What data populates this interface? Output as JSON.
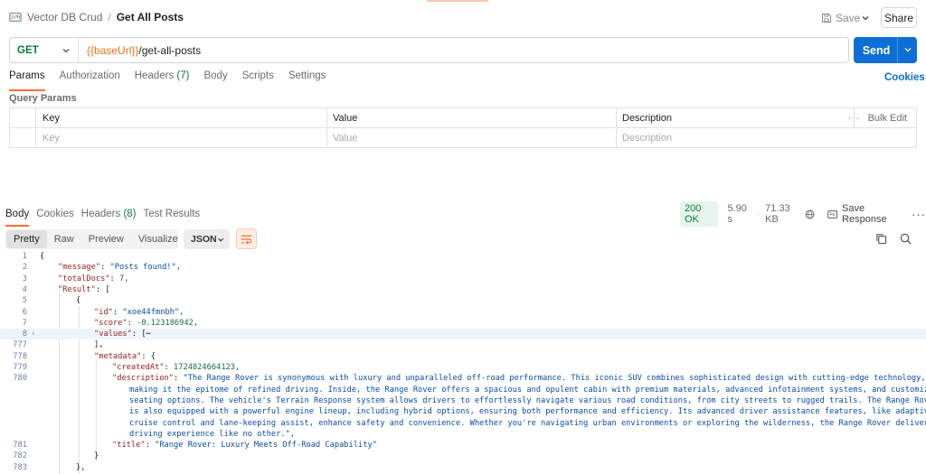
{
  "header": {
    "collection": "Vector DB Crud",
    "separator": "/",
    "request_name": "Get All Posts",
    "save_label": "Save",
    "share_label": "Share"
  },
  "request": {
    "method": "GET",
    "url_var": "{{baseUrl}}",
    "url_path": "/get-all-posts",
    "send_label": "Send"
  },
  "request_tabs": [
    {
      "label": "Params",
      "count": ""
    },
    {
      "label": "Authorization",
      "count": ""
    },
    {
      "label": "Headers",
      "count": "(7)"
    },
    {
      "label": "Body",
      "count": ""
    },
    {
      "label": "Scripts",
      "count": ""
    },
    {
      "label": "Settings",
      "count": ""
    }
  ],
  "cookies_link": "Cookies",
  "query_params": {
    "title": "Query Params",
    "columns": [
      "Key",
      "Value",
      "Description"
    ],
    "bulk_edit": "Bulk Edit",
    "placeholders": [
      "Key",
      "Value",
      "Description"
    ]
  },
  "response_tabs": [
    {
      "label": "Body",
      "count": ""
    },
    {
      "label": "Cookies",
      "count": ""
    },
    {
      "label": "Headers",
      "count": "(8)"
    },
    {
      "label": "Test Results",
      "count": ""
    }
  ],
  "response_meta": {
    "status": "200 OK",
    "time": "5.90 s",
    "size": "71.33 KB",
    "save_response": "Save Response"
  },
  "viewer": {
    "modes": [
      "Pretty",
      "Raw",
      "Preview",
      "Visualize"
    ],
    "format": "JSON"
  },
  "code_lines": [
    {
      "num": "1",
      "text": "{"
    },
    {
      "num": "2",
      "text": "\"message\": \"Posts found!\","
    },
    {
      "num": "3",
      "text": "\"totalDocs\": 7,"
    },
    {
      "num": "4",
      "text": "\"Result\": ["
    },
    {
      "num": "5",
      "text": "{"
    },
    {
      "num": "6",
      "text": "\"id\": \"xoe44fmnbh\","
    },
    {
      "num": "7",
      "text": "\"score\": -0.123186942,"
    },
    {
      "num": "8",
      "text": "\"values\": [⋯"
    },
    {
      "num": "777",
      "text": "],"
    },
    {
      "num": "778",
      "text": "\"metadata\": {"
    },
    {
      "num": "779",
      "text": "\"createdAt\": 1724824664123,"
    },
    {
      "num": "780",
      "text": "\"description\": \"The Range Rover is synonymous with luxury and unparalleled off-road performance. This iconic SUV combines sophisticated design with cutting-edge technology,"
    },
    {
      "num": "",
      "text": "making it the epitome of refined driving. Inside, the Range Rover offers a spacious and opulent cabin with premium materials, advanced infotainment systems, and customizable"
    },
    {
      "num": "",
      "text": "seating options. The vehicle's Terrain Response system allows drivers to effortlessly navigate various road conditions, from city streets to rugged trails. The Range Rover"
    },
    {
      "num": "",
      "text": "is also equipped with a powerful engine lineup, including hybrid options, ensuring both performance and efficiency. Its advanced driver assistance features, like adaptive"
    },
    {
      "num": "",
      "text": "cruise control and lane-keeping assist, enhance safety and convenience. Whether you're navigating urban environments or exploring the wilderness, the Range Rover delivers a"
    },
    {
      "num": "",
      "text": "driving experience like no other.\","
    },
    {
      "num": "781",
      "text": "\"title\": \"Range Rover: Luxury Meets Off-Road Capability\""
    },
    {
      "num": "782",
      "text": "}"
    },
    {
      "num": "783",
      "text": "},"
    }
  ]
}
